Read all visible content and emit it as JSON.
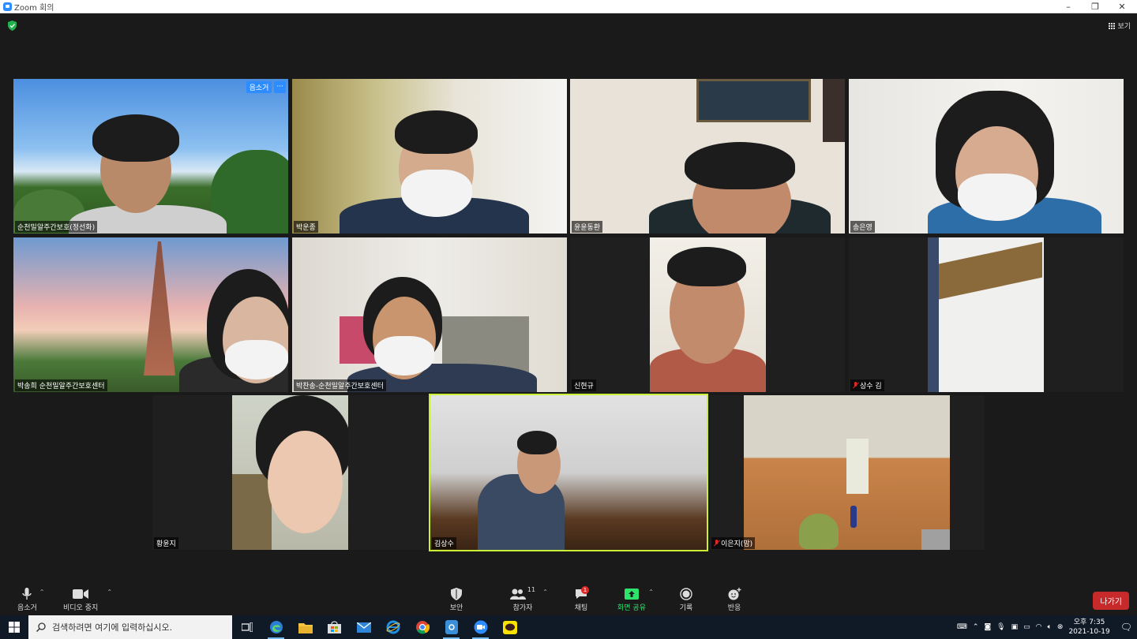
{
  "window": {
    "title": "Zoom 회의",
    "minimize": "–",
    "restore": "❐",
    "close": "✕"
  },
  "header": {
    "view_label": "보기"
  },
  "participants": [
    {
      "name": "순천밀알주간보호(정선화)",
      "muted": false
    },
    {
      "name": "박운종",
      "muted": false
    },
    {
      "name": "윤윤동환",
      "muted": false
    },
    {
      "name": "송은영",
      "muted": false
    },
    {
      "name": "박송희 순천밀알주간보호센터",
      "muted": false
    },
    {
      "name": "박찬송-순천밀알주간보호센터",
      "muted": false
    },
    {
      "name": "신현규",
      "muted": false
    },
    {
      "name": "상수 김",
      "muted": true
    },
    {
      "name": "황윤지",
      "muted": false
    },
    {
      "name": "김상수",
      "muted": false,
      "active_speaker": true
    },
    {
      "name": "이은지(맘)",
      "muted": true
    }
  ],
  "tile_menu": {
    "mute_label": "음소거",
    "more_label": "···"
  },
  "toolbar": {
    "mute_label": "음소거",
    "video_label": "비디오 중지",
    "security_label": "보안",
    "participants_label": "참가자",
    "participants_count": "11",
    "chat_label": "채팅",
    "chat_badge": "1",
    "share_label": "화면 공유",
    "record_label": "기록",
    "reactions_label": "반응",
    "leave_label": "나가기"
  },
  "taskbar": {
    "search_placeholder": "검색하려면 여기에 입력하십시오.",
    "time": "오후 7:35",
    "date": "2021-10-19"
  },
  "colors": {
    "accent": "#2d8cff",
    "share": "#2ee36b",
    "leave": "#c72a2a",
    "active_speaker": "#c9ef37"
  }
}
